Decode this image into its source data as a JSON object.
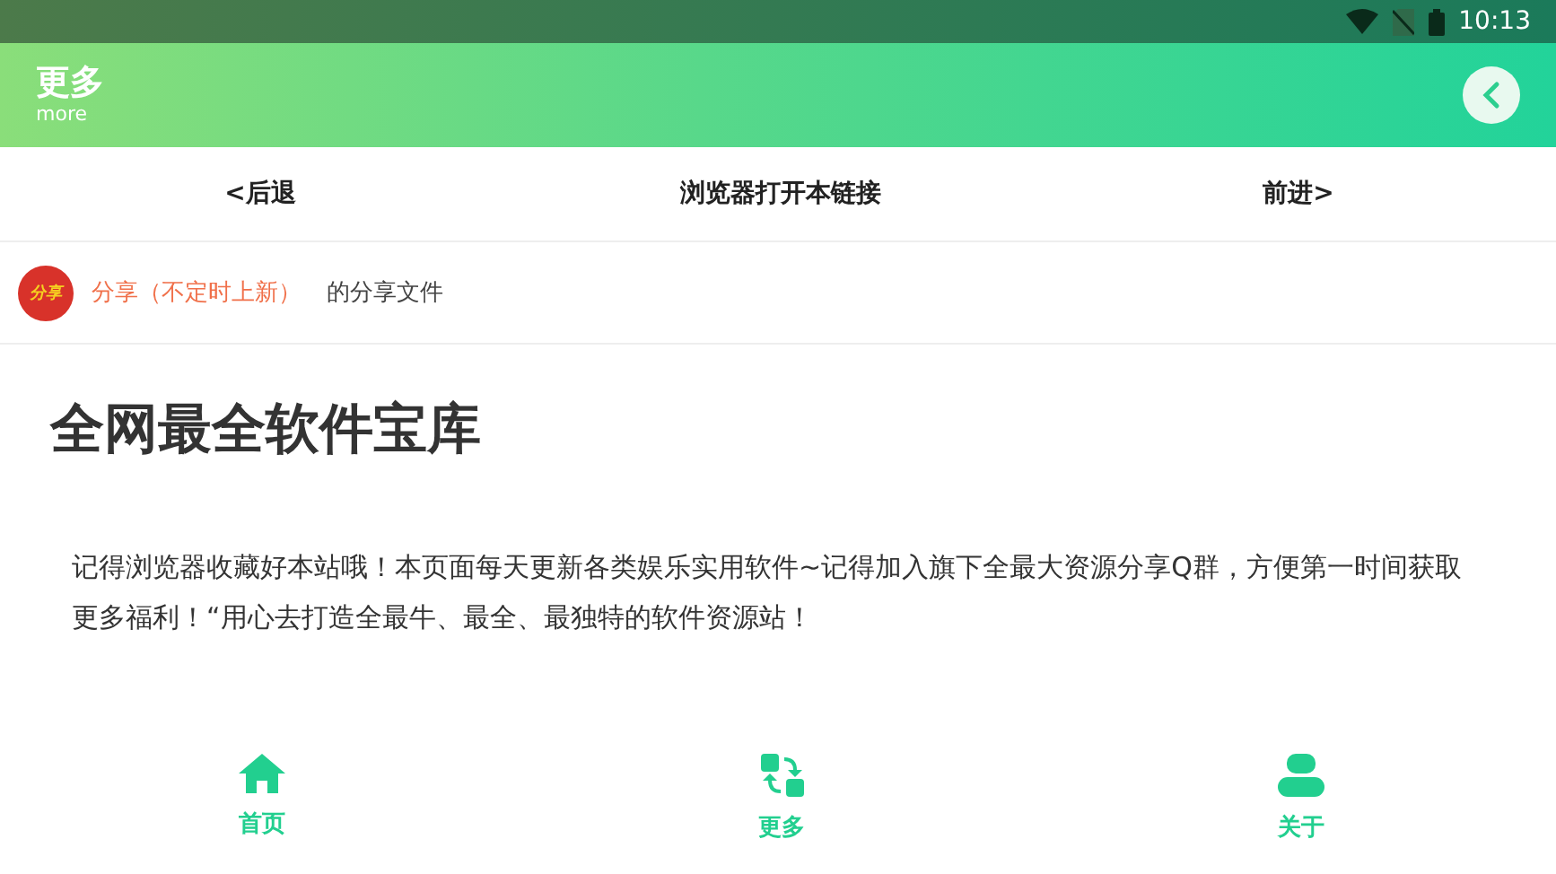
{
  "status_bar": {
    "time": "10:13"
  },
  "header": {
    "title": "更多",
    "subtitle": "more"
  },
  "browser_nav": [
    "<后退",
    "浏览器打开本链接",
    "前进>"
  ],
  "share": {
    "badge": "分享",
    "name": "分享（不定时上新）",
    "suffix": "的分享文件"
  },
  "article": {
    "heading": "全网最全软件宝库",
    "body": "记得浏览器收藏好本站哦！本页面每天更新各类娱乐实用软件~记得加入旗下全最大资源分享Q群，方便第一时间获取更多福利！“用心去打造全最牛、最全、最独特的软件资源站！"
  },
  "bottom_nav": [
    {
      "kind": "home",
      "label": "首页"
    },
    {
      "kind": "more",
      "label": "更多"
    },
    {
      "kind": "about",
      "label": "关于"
    }
  ]
}
